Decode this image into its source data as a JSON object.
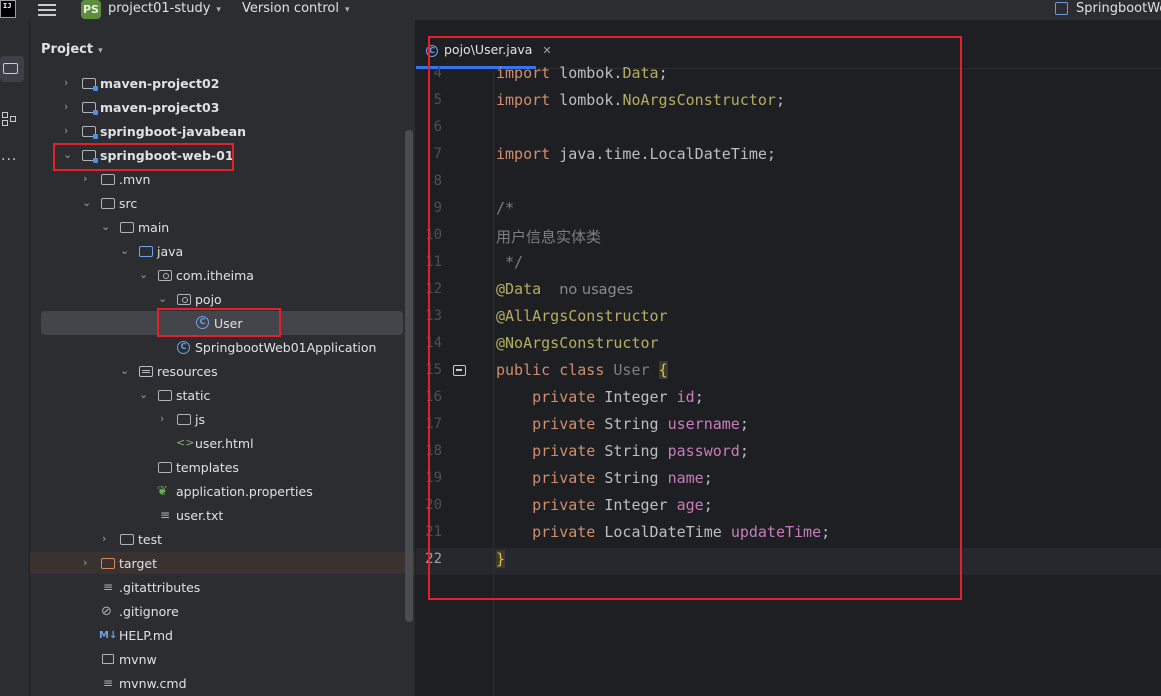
{
  "titlebar": {
    "logo_text": "IJ",
    "project_badge": "PS",
    "project_name": "project01-study",
    "vcs": "Version control",
    "right_project": "SpringbootWe"
  },
  "project_panel": {
    "title": "Project",
    "tree": [
      {
        "label": "maven-project02",
        "bold": true
      },
      {
        "label": "maven-project03",
        "bold": true
      },
      {
        "label": "springboot-javabean",
        "bold": true
      },
      {
        "label": "springboot-web-01",
        "bold": true
      },
      {
        "label": ".mvn"
      },
      {
        "label": "src"
      },
      {
        "label": "main"
      },
      {
        "label": "java"
      },
      {
        "label": "com.itheima"
      },
      {
        "label": "pojo"
      },
      {
        "label": "User"
      },
      {
        "label": "SpringbootWeb01Application"
      },
      {
        "label": "resources"
      },
      {
        "label": "static"
      },
      {
        "label": "js"
      },
      {
        "label": "user.html"
      },
      {
        "label": "templates"
      },
      {
        "label": "application.properties"
      },
      {
        "label": "user.txt"
      },
      {
        "label": "test"
      },
      {
        "label": "target"
      },
      {
        "label": ".gitattributes"
      },
      {
        "label": ".gitignore"
      },
      {
        "label": "HELP.md"
      },
      {
        "label": "mvnw"
      },
      {
        "label": "mvnw.cmd"
      }
    ],
    "md_badge": "M↓"
  },
  "editor": {
    "tab_label": "pojo\\User.java",
    "class_icon": "C",
    "line_numbers": [
      "4",
      "5",
      "6",
      "7",
      "8",
      "9",
      "10",
      "11",
      "12",
      "13",
      "14",
      "15",
      "16",
      "17",
      "18",
      "19",
      "20",
      "21",
      "22"
    ],
    "code": {
      "l4_kw": "import",
      "l4_rest": " lombok.",
      "l4_ann": "Data",
      "l4_end": ";",
      "l5_kw": "import",
      "l5_rest": " lombok.",
      "l5_ann": "NoArgsConstructor",
      "l5_end": ";",
      "l7_kw": "import",
      "l7_rest": " java.time.LocalDateTime;",
      "l9": "/*",
      "l10": "用户信息实体类",
      "l11": " */",
      "l12_ann": "@Data",
      "l12_hint": "no usages",
      "l13_ann": "@AllArgsConstructor",
      "l14_ann": "@NoArgsConstructor",
      "l15_kw": "public class",
      "l15_name": " User ",
      "l15_brace": "{",
      "l16_kw": "private",
      "l16_type": " Integer ",
      "l16_fld": "id",
      "l16_end": ";",
      "l17_kw": "private",
      "l17_type": " String ",
      "l17_fld": "username",
      "l17_end": ";",
      "l18_kw": "private",
      "l18_type": " String ",
      "l18_fld": "password",
      "l18_end": ";",
      "l19_kw": "private",
      "l19_type": " String ",
      "l19_fld": "name",
      "l19_end": ";",
      "l20_kw": "private",
      "l20_type": " Integer ",
      "l20_fld": "age",
      "l20_end": ";",
      "l21_kw": "private",
      "l21_type": " LocalDateTime ",
      "l21_fld": "updateTime",
      "l21_end": ";",
      "l22_brace": "}"
    }
  },
  "colors": {
    "keyword": "#cf8e6d",
    "annotation": "#b3ae60",
    "field": "#c77dbb",
    "comment": "#7a7e85",
    "highlight_box": "#e5202a",
    "accent": "#3574f0"
  }
}
